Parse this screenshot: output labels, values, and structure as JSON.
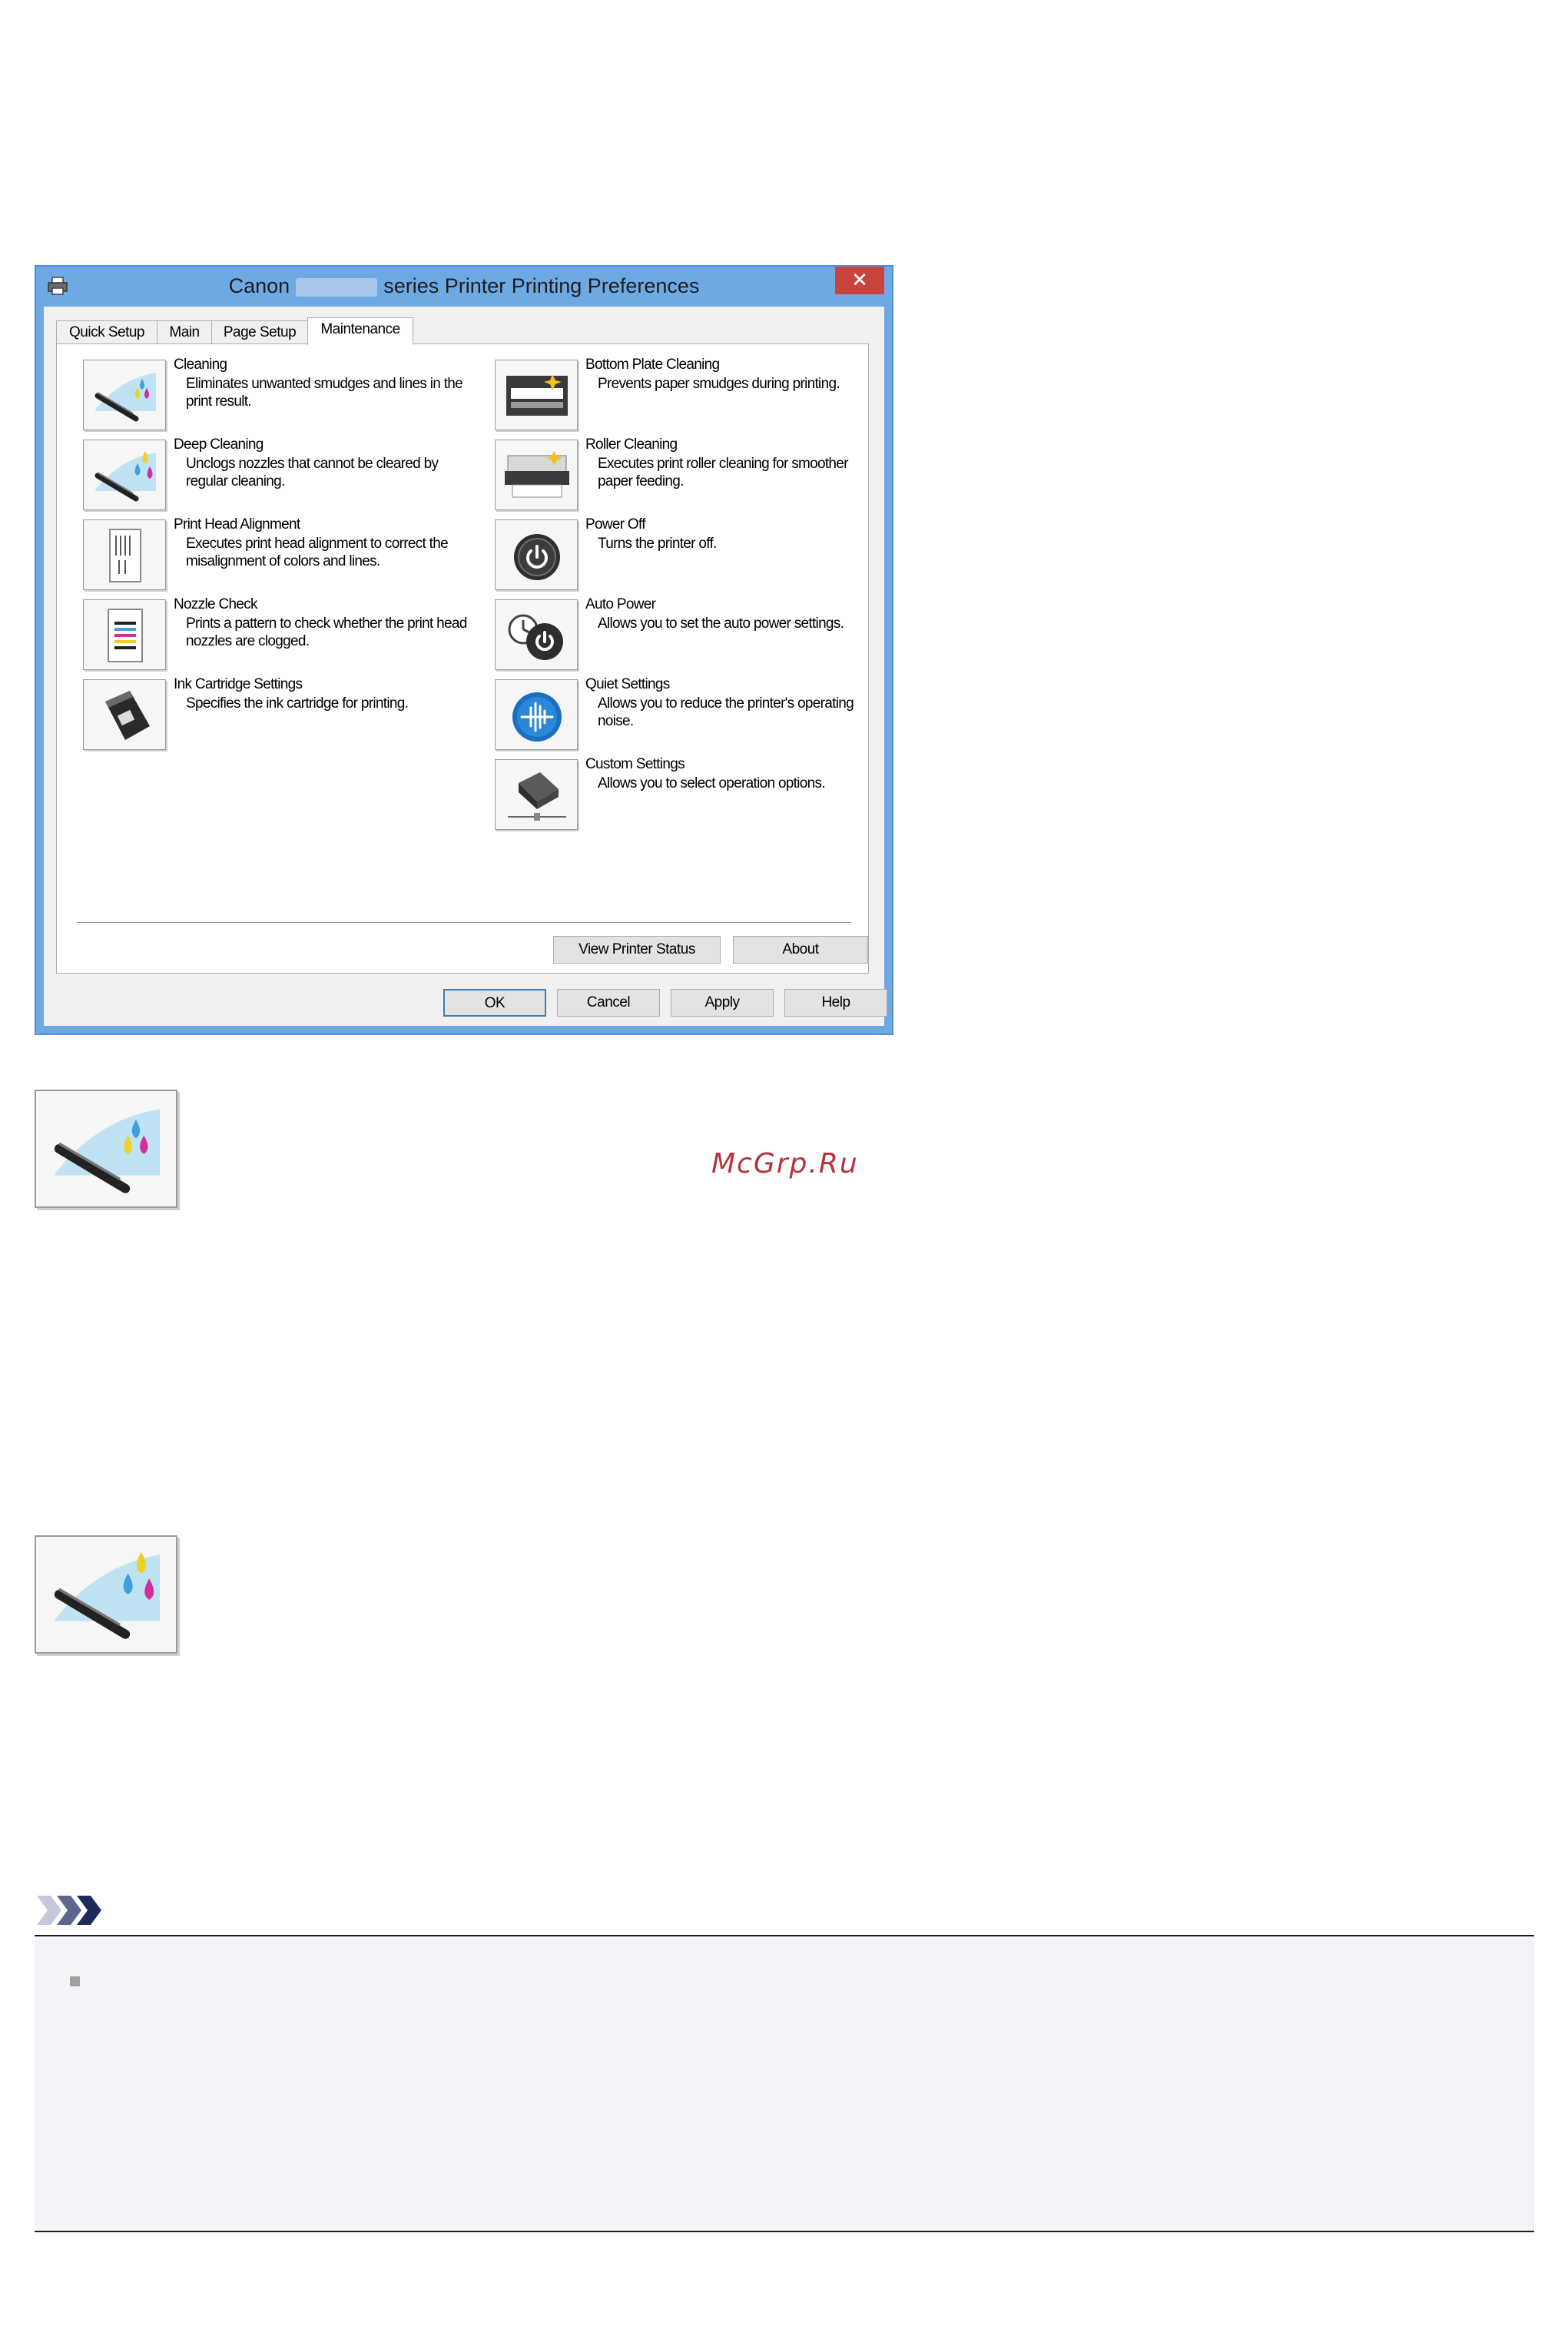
{
  "window": {
    "title_prefix": "Canon",
    "title_suffix": "series Printer Printing Preferences",
    "close_label": "✕"
  },
  "tabs": [
    {
      "label": "Quick Setup"
    },
    {
      "label": "Main"
    },
    {
      "label": "Page Setup"
    },
    {
      "label": "Maintenance"
    }
  ],
  "active_tab": "Maintenance",
  "left_items": [
    {
      "title": "Cleaning",
      "desc": "Eliminates unwanted smudges and lines in the print result.",
      "icon": "cleaning-icon"
    },
    {
      "title": "Deep Cleaning",
      "desc": "Unclogs nozzles that cannot be cleared by regular cleaning.",
      "icon": "deep-cleaning-icon"
    },
    {
      "title": "Print Head Alignment",
      "desc": "Executes print head alignment to correct the misalignment of colors and lines.",
      "icon": "print-head-alignment-icon"
    },
    {
      "title": "Nozzle Check",
      "desc": "Prints a pattern to check whether the print head nozzles are clogged.",
      "icon": "nozzle-check-icon"
    },
    {
      "title": "Ink Cartridge Settings",
      "desc": "Specifies the ink cartridge for printing.",
      "icon": "ink-cartridge-icon"
    }
  ],
  "right_items": [
    {
      "title": "Bottom Plate Cleaning",
      "desc": "Prevents paper smudges during printing.",
      "icon": "bottom-plate-cleaning-icon"
    },
    {
      "title": "Roller Cleaning",
      "desc": "Executes print roller cleaning for smoother paper feeding.",
      "icon": "roller-cleaning-icon"
    },
    {
      "title": "Power Off",
      "desc": "Turns the printer off.",
      "icon": "power-off-icon"
    },
    {
      "title": "Auto Power",
      "desc": "Allows you to set the auto power settings.",
      "icon": "auto-power-icon"
    },
    {
      "title": "Quiet Settings",
      "desc": "Allows you to reduce the printer's operating noise.",
      "icon": "quiet-settings-icon"
    },
    {
      "title": "Custom Settings",
      "desc": "Allows you to select operation options.",
      "icon": "custom-settings-icon"
    }
  ],
  "panel_buttons": {
    "view_printer_status": "View Printer Status",
    "about": "About"
  },
  "dialog_buttons": {
    "ok": "OK",
    "cancel": "Cancel",
    "apply": "Apply",
    "help": "Help"
  },
  "watermark": "McGrp.Ru",
  "colors": {
    "window_frame": "#6fa9e4",
    "close_button": "#c7453c",
    "watermark": "#b5333c",
    "note_icon": "#1f2a5c"
  }
}
